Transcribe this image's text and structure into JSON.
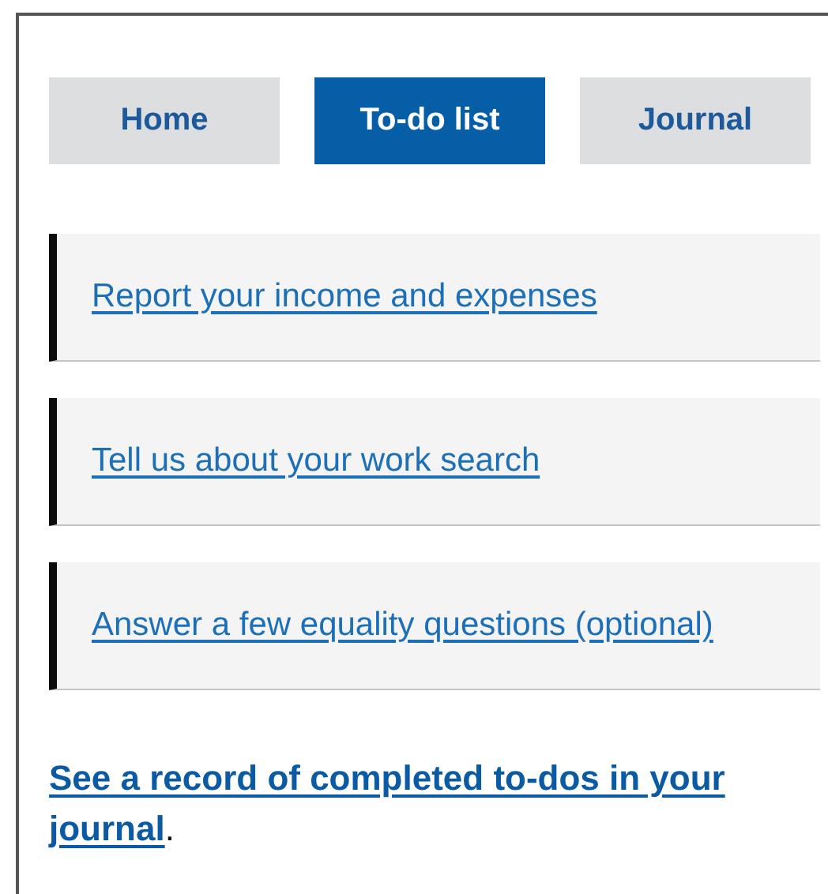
{
  "tabs": [
    {
      "label": "Home",
      "selected": false
    },
    {
      "label": "To-do list",
      "selected": true
    },
    {
      "label": "Journal",
      "selected": false
    }
  ],
  "tasks": [
    {
      "label": "Report your income and expenses"
    },
    {
      "label": "Tell us about your work search"
    },
    {
      "label": "Answer a few equality questions (optional)"
    }
  ],
  "footer": {
    "link": "See a record of completed to-dos in your journal",
    "suffix": "."
  }
}
